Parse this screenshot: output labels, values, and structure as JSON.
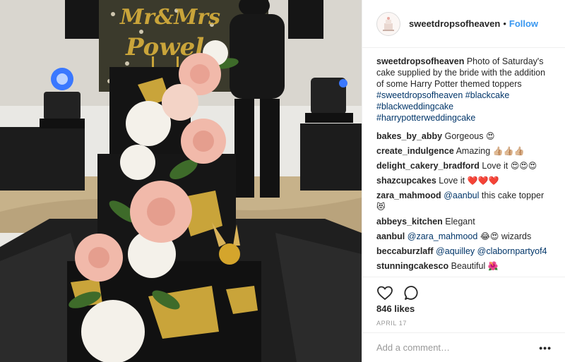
{
  "post": {
    "username": "sweetdropsofheaven",
    "separator": "•",
    "follow_label": "Follow",
    "photo": {
      "topper_text": "Mr&Mrs Powel",
      "colors": {
        "cake": "#141414",
        "gold": "#c9a43a",
        "rose": "#f1b9aa",
        "hydrangea": "#f4f1ea",
        "leaf": "#3e6b2a",
        "light_blue": "#3a78ff"
      }
    }
  },
  "caption": {
    "username": "sweetdropsofheaven",
    "text": "Photo of Saturday's cake supplied by the bride with the addition of some Harry Potter themed toppers",
    "hashtags": [
      "#sweetdropsofheaven",
      "#blackcake",
      "#blackweddingcake",
      "#harrypotterweddingcake"
    ]
  },
  "comments": [
    {
      "user": "bakes_by_abby",
      "text": "Gorgeous",
      "emoji": "😍"
    },
    {
      "user": "create_indulgence",
      "text": "Amazing",
      "emoji": "👍🏼👍🏼👍🏼"
    },
    {
      "user": "delight_cakery_bradford",
      "text": "Love it",
      "emoji": "😍😍😍"
    },
    {
      "user": "shazcupcakes",
      "text": "Love it",
      "emoji": "❤️❤️❤️"
    },
    {
      "user": "zara_mahmood",
      "mention": "@aanbul",
      "text": "this cake topper",
      "emoji": "😻"
    },
    {
      "user": "abbeys_kitchen",
      "text": "Elegant"
    },
    {
      "user": "aanbul",
      "mention": "@zara_mahmood",
      "emoji": "😂😍",
      "text": "wizards"
    },
    {
      "user": "beccaburzlaff",
      "mention": "@aquilley",
      "mention2": "@clabornpartyof4"
    },
    {
      "user": "stunningcakesco",
      "text": "Beautiful",
      "emoji": "🌺"
    }
  ],
  "actions": {
    "like_icon": "heart-icon",
    "comment_icon": "comment-bubble-icon",
    "likes": "846 likes",
    "date": "APRIL 17",
    "add_comment_placeholder": "Add a comment…",
    "more_label": "•••"
  }
}
